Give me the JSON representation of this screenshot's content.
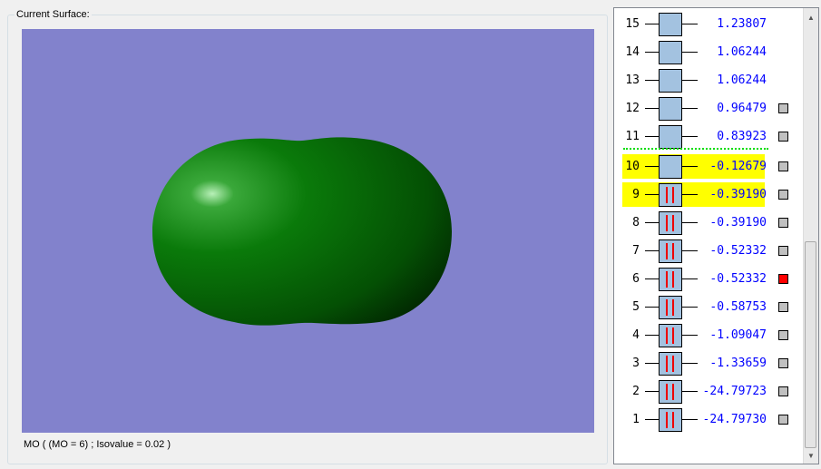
{
  "surface_panel": {
    "title": "Current Surface:",
    "status": "MO ( (MO = 6) ; Isovalue = 0.02 )",
    "background_color": "#8282cc",
    "surface_color": "#0a7a0a"
  },
  "orbitals": [
    {
      "n": "15",
      "energy": "1.23807",
      "occupied": false,
      "highlight": false,
      "checkbox": "none"
    },
    {
      "n": "14",
      "energy": "1.06244",
      "occupied": false,
      "highlight": false,
      "checkbox": "none"
    },
    {
      "n": "13",
      "energy": "1.06244",
      "occupied": false,
      "highlight": false,
      "checkbox": "none"
    },
    {
      "n": "12",
      "energy": "0.96479",
      "occupied": false,
      "highlight": false,
      "checkbox": "gray"
    },
    {
      "n": "11",
      "energy": "0.83923",
      "occupied": false,
      "highlight": false,
      "checkbox": "gray"
    },
    {
      "n": "10",
      "energy": "-0.12679",
      "occupied": false,
      "highlight": true,
      "checkbox": "gray"
    },
    {
      "n": "9",
      "energy": "-0.39190",
      "occupied": true,
      "highlight": true,
      "checkbox": "gray"
    },
    {
      "n": "8",
      "energy": "-0.39190",
      "occupied": true,
      "highlight": false,
      "checkbox": "gray"
    },
    {
      "n": "7",
      "energy": "-0.52332",
      "occupied": true,
      "highlight": false,
      "checkbox": "gray"
    },
    {
      "n": "6",
      "energy": "-0.52332",
      "occupied": true,
      "highlight": false,
      "checkbox": "red"
    },
    {
      "n": "5",
      "energy": "-0.58753",
      "occupied": true,
      "highlight": false,
      "checkbox": "gray"
    },
    {
      "n": "4",
      "energy": "-1.09047",
      "occupied": true,
      "highlight": false,
      "checkbox": "gray"
    },
    {
      "n": "3",
      "energy": "-1.33659",
      "occupied": true,
      "highlight": false,
      "checkbox": "gray"
    },
    {
      "n": "2",
      "energy": "-24.79723",
      "occupied": true,
      "highlight": false,
      "checkbox": "gray"
    },
    {
      "n": "1",
      "energy": "-24.79730",
      "occupied": true,
      "highlight": false,
      "checkbox": "gray"
    }
  ]
}
